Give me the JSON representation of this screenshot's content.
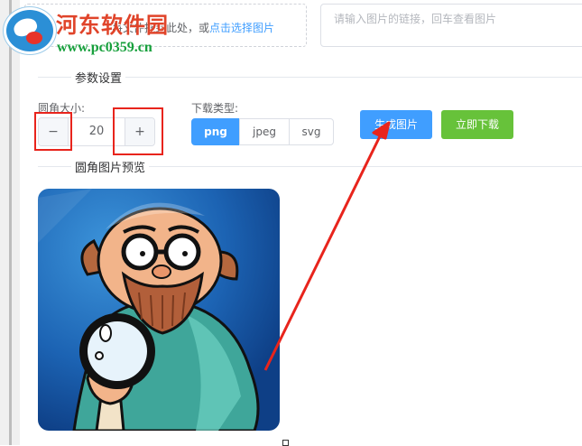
{
  "watermark": {
    "title": "河东软件园",
    "url": "www.pc0359.cn"
  },
  "upload": {
    "text": "将文件拖到此处，或",
    "link": "点击选择图片"
  },
  "url_input": {
    "placeholder": "请输入图片的链接，回车查看图片"
  },
  "settings": {
    "section_title": "参数设置",
    "radius_label": "圆角大小:",
    "radius_value": "20",
    "minus": "−",
    "plus": "+",
    "type_label": "下载类型:",
    "types": [
      "png",
      "jpeg",
      "svg"
    ],
    "selected_type": "png"
  },
  "actions": {
    "generate": "生成图片",
    "download": "立即下载"
  },
  "preview": {
    "section_title": "圆角图片预览"
  },
  "colors": {
    "primary": "#409eff",
    "success": "#67c23a",
    "highlight": "#e8241c"
  }
}
